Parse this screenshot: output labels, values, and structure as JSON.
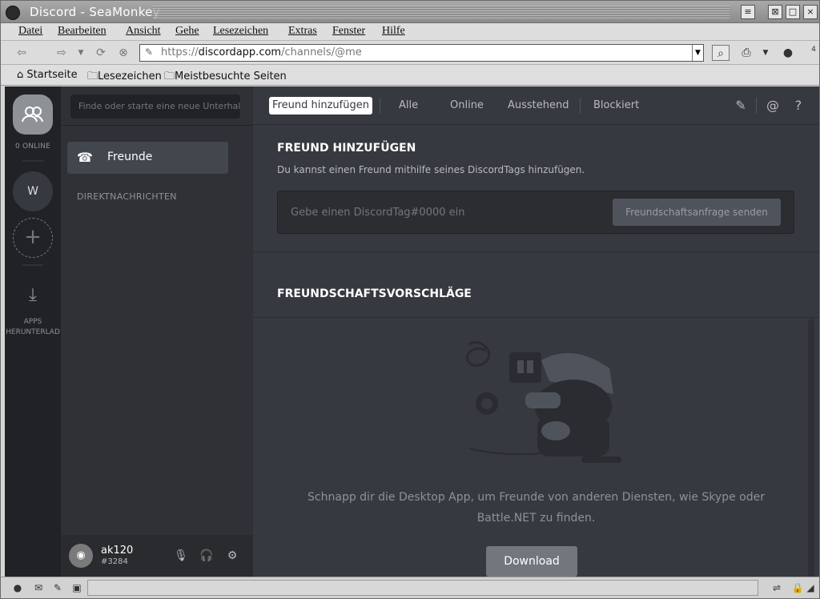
{
  "window": {
    "title": "Discord - SeaMonkey"
  },
  "menu": [
    "Datei",
    "Bearbeiten",
    "Ansicht",
    "Gehe",
    "Lesezeichen",
    "Extras",
    "Fenster",
    "Hilfe"
  ],
  "navigation": {
    "url_scheme": "https://",
    "url_host": "discordapp.com",
    "url_path": "/channels/@me",
    "badge": "4"
  },
  "bookmarks": [
    "Startseite",
    "Lesezeichen",
    "Meistbesuchte Seiten"
  ],
  "discord": {
    "guilds": {
      "online_label": "0 ONLINE",
      "server_initial": "W",
      "add_symbol": "+",
      "download_label_line1": "APPS",
      "download_label_line2": "HERUNTERLAD"
    },
    "channels": {
      "search_placeholder": "Finde oder starte eine neue Unterhaltung",
      "friends_label": "Freunde",
      "dm_header": "DIREKTNACHRICHTEN"
    },
    "user": {
      "name": "ak120",
      "tag": "#3284"
    },
    "tabs": {
      "add_friend": "Freund hinzufügen",
      "all": "Alle",
      "online": "Online",
      "pending": "Ausstehend",
      "blocked": "Blockiert"
    },
    "add_friend_section": {
      "heading": "FREUND HINZUFÜGEN",
      "description": "Du kannst einen Freund mithilfe seines DiscordTags hinzufügen.",
      "input_placeholder": "Gebe einen DiscordTag#0000 ein",
      "send_button": "Freundschaftsanfrage senden"
    },
    "suggestions": {
      "heading": "FREUNDSCHAFTSVORSCHLÄGE",
      "message": "Schnapp dir die Desktop App, um Freunde von anderen Diensten, wie Skype oder Battle.NET zu finden.",
      "download_button": "Download"
    }
  }
}
